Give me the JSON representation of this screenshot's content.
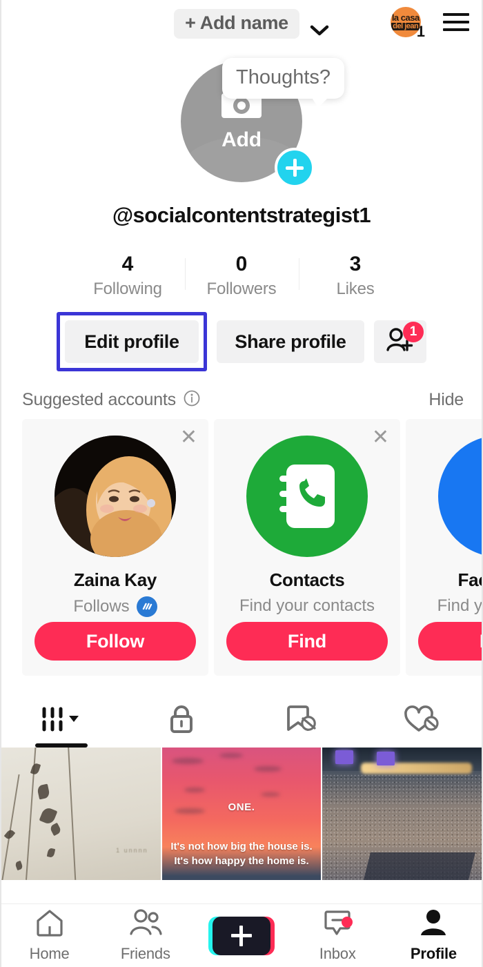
{
  "header": {
    "add_name_label": "+ Add name",
    "chevron_icon": "chevron-down-icon",
    "brand_avatar": {
      "line1": "la casa",
      "line2": "del jean",
      "icon": "brand-avatar-icon"
    },
    "brand_count": "1",
    "menu_icon": "hamburger-menu-icon"
  },
  "profile": {
    "thought_bubble": "Thoughts?",
    "avatar_label": "Add",
    "avatar_camera_icon": "camera-icon",
    "avatar_plus_icon": "plus-circle-icon",
    "username": "@socialcontentstrategist1",
    "stats": [
      {
        "num": "4",
        "label": "Following"
      },
      {
        "num": "0",
        "label": "Followers"
      },
      {
        "num": "3",
        "label": "Likes"
      }
    ],
    "actions": {
      "edit_label": "Edit profile",
      "share_label": "Share profile",
      "find_friends_icon": "add-person-icon",
      "find_friends_badge": "1",
      "highlight_color": "#3b35d6"
    }
  },
  "suggested": {
    "title": "Suggested accounts",
    "info_icon": "info-icon",
    "hide_label": "Hide",
    "cards": [
      {
        "type": "account",
        "close_icon": "close-icon",
        "avatar_icon": "user-photo-avatar",
        "name": "Zaina Kay",
        "subtitle": "Follows",
        "badge_icon": "follows-you-badge-icon",
        "button_label": "Follow"
      },
      {
        "type": "contacts",
        "close_icon": "close-icon",
        "avatar_icon": "contacts-book-icon",
        "name": "Contacts",
        "subtitle": "Find your contacts",
        "button_label": "Find"
      },
      {
        "type": "facebook",
        "close_icon": "close-icon",
        "avatar_icon": "facebook-icon",
        "name": "Facebook",
        "subtitle": "Find your friends",
        "button_label": "Find"
      }
    ]
  },
  "tabs": [
    {
      "icon": "grid-posts-icon",
      "active": true,
      "has_dropdown": true
    },
    {
      "icon": "lock-private-icon",
      "active": false
    },
    {
      "icon": "bookmark-off-icon",
      "active": false
    },
    {
      "icon": "heart-off-icon",
      "active": false
    }
  ],
  "videos": [
    {
      "overlay_text": "1 unnnn"
    },
    {
      "overlay_title": "ONE.",
      "overlay_line1": "It's not how big the house is.",
      "overlay_line2": "It's how happy the home is."
    },
    {
      "overlay_text": ""
    }
  ],
  "bottom_nav": [
    {
      "icon": "home-icon",
      "label": "Home",
      "active": false
    },
    {
      "icon": "friends-icon",
      "label": "Friends",
      "active": false
    },
    {
      "icon": "create-plus-icon",
      "label": "",
      "active": false
    },
    {
      "icon": "inbox-icon",
      "label": "Inbox",
      "active": false,
      "badge": true
    },
    {
      "icon": "profile-person-icon",
      "label": "Profile",
      "active": true
    }
  ],
  "colors": {
    "accent_red": "#fe2c55",
    "accent_cyan": "#25f4ee",
    "highlight": "#3b35d6"
  }
}
